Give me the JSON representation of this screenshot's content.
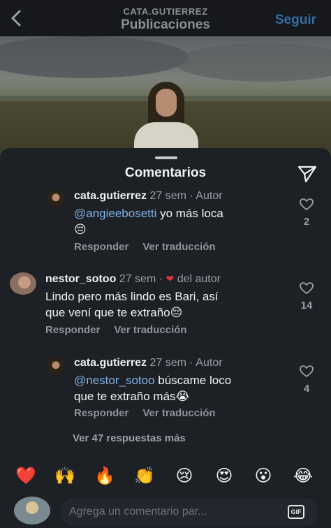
{
  "header": {
    "username": "CATA.GUTIERREZ",
    "title": "Publicaciones",
    "follow_label": "Seguir",
    "back_icon": "chevron-left-icon"
  },
  "sheet": {
    "title": "Comentarios",
    "share_icon": "paper-plane-icon"
  },
  "comments": [
    {
      "user": "cata.gutierrez",
      "meta": "27 sem · Autor",
      "mention": "@angieebosetti",
      "text": " yo más loca",
      "line2": "😔",
      "reply_label": "Responder",
      "translate_label": "Ver traducción",
      "likes": "2"
    },
    {
      "user": "nestor_sotoo",
      "meta": "27 sem ·",
      "author_heart": "❤",
      "author_label": "del autor",
      "line1": "Lindo pero más lindo es Bari, así",
      "line2": "que vení que te extraño😔",
      "reply_label": "Responder",
      "translate_label": "Ver traducción",
      "likes": "14"
    },
    {
      "user": "cata.gutierrez",
      "meta": "27 sem · Autor",
      "mention": "@nestor_sotoo",
      "text": " búscame loco",
      "line2": "que te extraño más😭",
      "reply_label": "Responder",
      "translate_label": "Ver traducción",
      "likes": "4"
    }
  ],
  "more_replies": "Ver 47 respuestas más",
  "emojis": [
    "❤️",
    "🙌",
    "🔥",
    "👏",
    "😢",
    "😍",
    "😮",
    "😂"
  ],
  "composer": {
    "placeholder": "Agrega un comentario par...",
    "gif_label": "GIF"
  },
  "colors": {
    "background": "#1d2025",
    "link": "#7fb3e8",
    "follow": "#2f6fa8",
    "heart": "#e0303f"
  }
}
